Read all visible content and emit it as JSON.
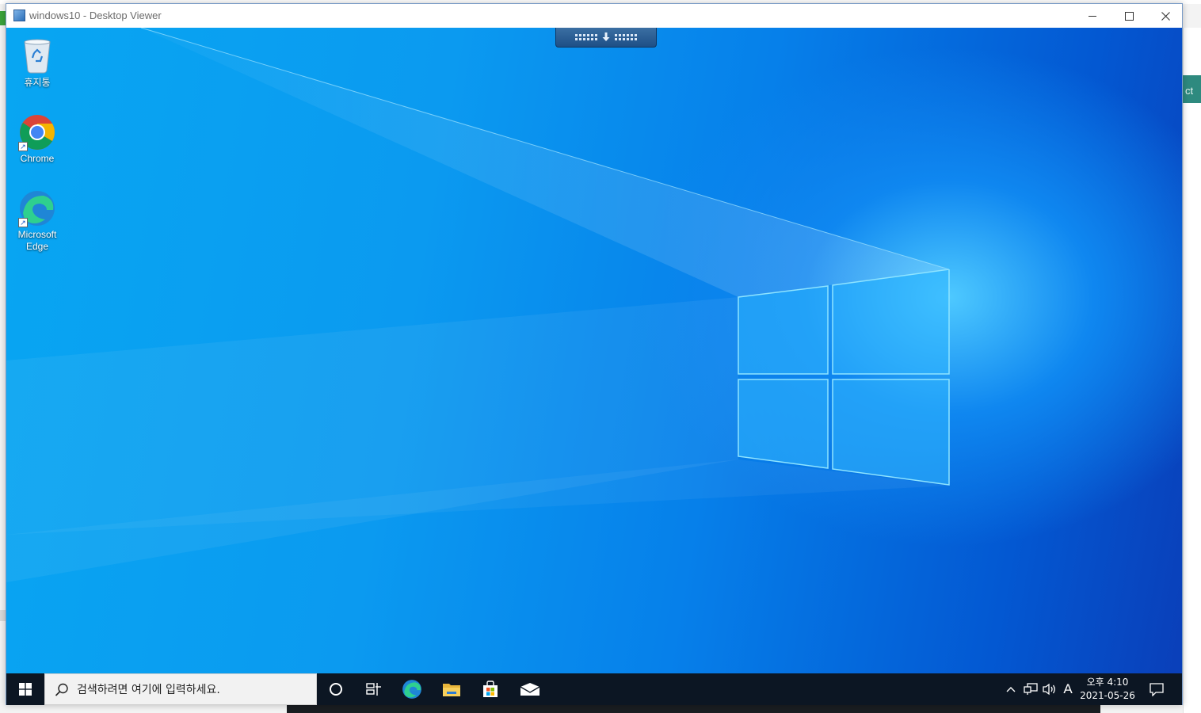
{
  "window": {
    "title": "windows10 - Desktop Viewer",
    "controls": {
      "minimize": "—",
      "maximize": "☐",
      "close": "✕"
    }
  },
  "desktop": {
    "icons": [
      {
        "label": "휴지통",
        "icon": "recycle-bin-icon"
      },
      {
        "label": "Chrome",
        "icon": "chrome-icon"
      },
      {
        "label": "Microsoft Edge",
        "icon": "edge-icon"
      }
    ],
    "wallpaper_colors": {
      "left": "#08a6f2",
      "right": "#0a3fb9",
      "glow": "#4ec9ff"
    }
  },
  "taskbar": {
    "search_placeholder": "검색하려면 여기에 입력하세요.",
    "pinned": [
      "cortana-icon",
      "task-view-icon",
      "edge-icon",
      "file-explorer-icon",
      "store-icon",
      "mail-icon"
    ],
    "tray": {
      "chevron": "^",
      "ime": "A"
    },
    "clock": {
      "time": "오후 4:10",
      "date": "2021-05-26"
    }
  },
  "host": {
    "right_panel_fragment": "ct"
  }
}
